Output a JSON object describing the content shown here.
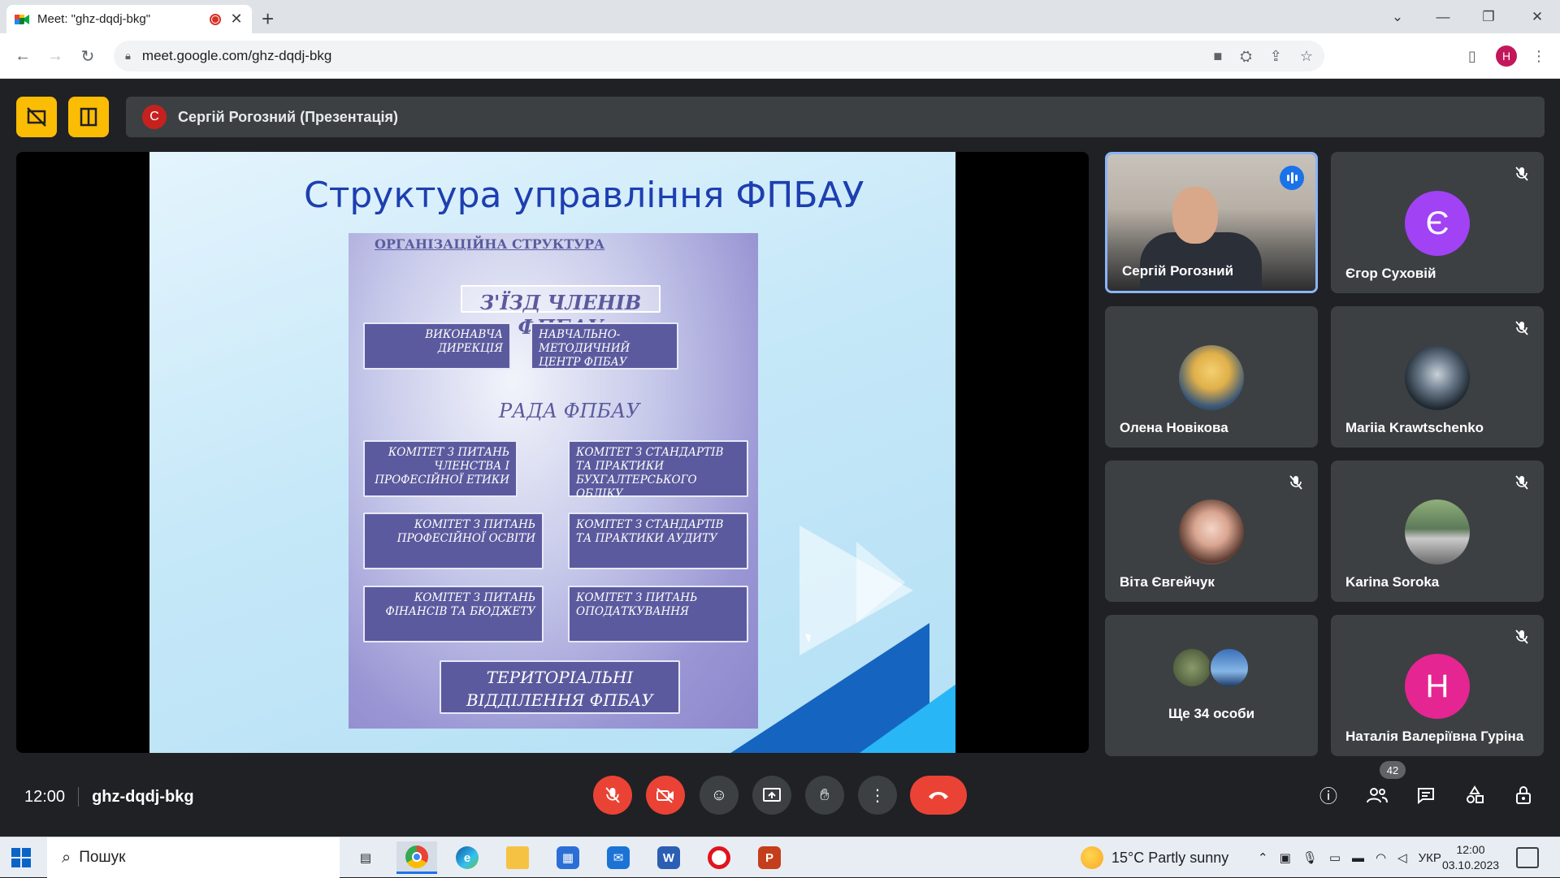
{
  "browser": {
    "tab_title": "Meet: \"ghz-dqdj-bkg\"",
    "url": "meet.google.com/ghz-dqdj-bkg",
    "profile_initial": "H"
  },
  "meet": {
    "presenter_initial": "С",
    "presenter_label": "Сергій Рогозний (Презентація)",
    "time": "12:00",
    "meeting_code": "ghz-dqdj-bkg",
    "participants_count": "42"
  },
  "slide": {
    "title": "Структура управління ФПБАУ",
    "org_header": "ОРГАНІЗАЦІЙНА СТРУКТУРА",
    "congress": "З'ЇЗД ЧЛЕНІВ ФПБАУ",
    "exec_direction": "ВИКОНАВЧА ДИРЕКЦІЯ",
    "training_center": "НАВЧАЛЬНО-МЕТОДИЧНИЙ ЦЕНТР ФПБАУ",
    "council": "РАДА ФПБАУ",
    "committee_membership": "КОМІТЕТ З ПИТАНЬ ЧЛЕНСТВА І ПРОФЕСІЙНОЇ ЕТИКИ",
    "committee_accounting": "КОМІТЕТ З СТАНДАРТІВ ТА ПРАКТИКИ БУХГАЛТЕРСЬКОГО ОБЛІКУ",
    "committee_education": "КОМІТЕТ З ПИТАНЬ ПРОФЕСІЙНОЇ ОСВІТИ",
    "committee_audit": "КОМІТЕТ З СТАНДАРТІВ ТА ПРАКТИКИ АУДИТУ",
    "committee_finance": "КОМІТЕТ З ПИТАНЬ ФІНАНСІВ ТА БЮДЖЕТУ",
    "committee_tax": "КОМІТЕТ З ПИТАНЬ ОПОДАТКУВАННЯ",
    "territorial": "ТЕРИТОРІАЛЬНІ ВІДДІЛЕННЯ ФПБАУ"
  },
  "participants": [
    {
      "name": "Сергій Рогозний",
      "initial": "",
      "color": "",
      "muted": false,
      "speaking": true
    },
    {
      "name": "Єгор Суховій",
      "initial": "Є",
      "color": "#a142f4",
      "muted": true
    },
    {
      "name": "Олена Новікова",
      "initial": "",
      "color": "#6b8fb8",
      "muted": false
    },
    {
      "name": "Mariia Krawtschenko",
      "initial": "",
      "color": "#2f3a44",
      "muted": true
    },
    {
      "name": "Віта Євгейчук",
      "initial": "",
      "color": "#c89c88",
      "muted": true
    },
    {
      "name": "Karina Soroka",
      "initial": "",
      "color": "#5d7a59",
      "muted": true
    },
    {
      "name": "Ще 34 особи",
      "initial": "",
      "color": "",
      "muted": false
    },
    {
      "name": "Наталія Валеріївна Гуріна",
      "initial": "Н",
      "color": "#e52592",
      "muted": true
    }
  ],
  "taskbar": {
    "search_placeholder": "Пошук",
    "weather": "15°C  Partly sunny",
    "lang": "УКР",
    "time": "12:00",
    "date": "03.10.2023"
  }
}
